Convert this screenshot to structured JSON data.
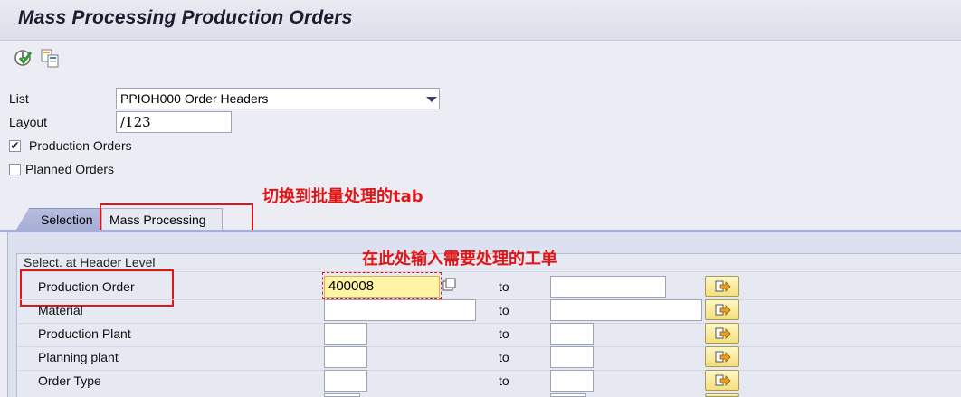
{
  "window": {
    "title": "Mass Processing Production Orders"
  },
  "toolbar": {
    "icons": [
      "execute-icon",
      "copy-variant-icon"
    ]
  },
  "form": {
    "list_label": "List",
    "list_value": "PPIOH000 Order Headers",
    "layout_label": "Layout",
    "layout_value": "/123",
    "production_orders_label": "Production Orders",
    "production_orders_checked": true,
    "planned_orders_label": "Planned Orders",
    "planned_orders_checked": false
  },
  "tabs": [
    {
      "label": "Selection",
      "active": true
    },
    {
      "label": "Mass Processing",
      "active": false
    }
  ],
  "group": {
    "title": "Select. at Header Level",
    "rows": [
      {
        "label": "Production Order",
        "from": "400008",
        "to_label": "to",
        "to": ""
      },
      {
        "label": "Material",
        "from": "",
        "to_label": "to",
        "to": ""
      },
      {
        "label": "Production Plant",
        "from": "",
        "to_label": "to",
        "to": ""
      },
      {
        "label": "Planning plant",
        "from": "",
        "to_label": "to",
        "to": ""
      },
      {
        "label": "Order Type",
        "from": "",
        "to_label": "to",
        "to": ""
      }
    ]
  },
  "annotations": {
    "tab_hint": "切换到批量处理的tab",
    "order_hint": "在此处输入需要处理的工单"
  },
  "colors": {
    "annotation_red": "#e01515",
    "highlight_field": "#fff3a6",
    "multi_select_button": "#f4df7a"
  }
}
